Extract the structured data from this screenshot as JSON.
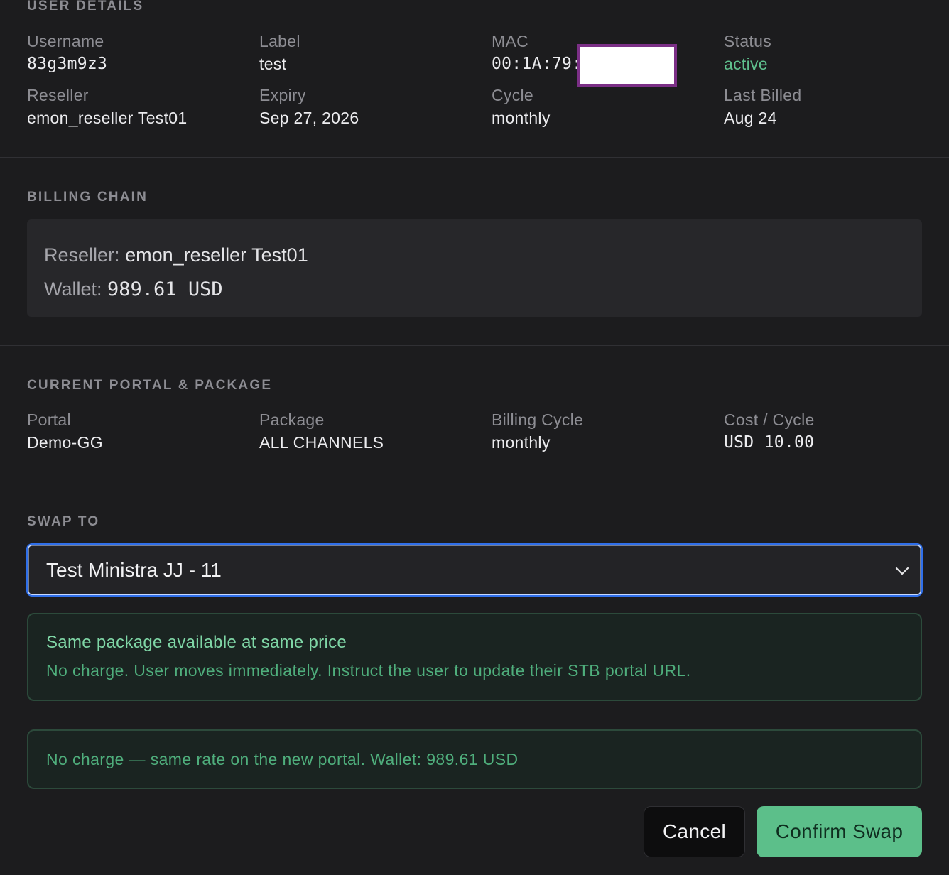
{
  "user_details": {
    "title": "USER DETAILS",
    "username": {
      "label": "Username",
      "value": "83g3m9z3"
    },
    "label": {
      "label": "Label",
      "value": "test"
    },
    "mac": {
      "label": "MAC",
      "value": "00:1A:79:"
    },
    "status": {
      "label": "Status",
      "value": "active"
    },
    "reseller": {
      "label": "Reseller",
      "value": "emon_reseller Test01"
    },
    "expiry": {
      "label": "Expiry",
      "value": "Sep 27, 2026"
    },
    "cycle": {
      "label": "Cycle",
      "value": "monthly"
    },
    "last_billed": {
      "label": "Last Billed",
      "value": "Aug 24"
    }
  },
  "billing_chain": {
    "title": "BILLING CHAIN",
    "reseller_key": "Reseller:",
    "reseller_value": "emon_reseller Test01",
    "wallet_key": "Wallet:",
    "wallet_value": "989.61 USD"
  },
  "current": {
    "title": "CURRENT PORTAL & PACKAGE",
    "portal": {
      "label": "Portal",
      "value": "Demo-GG"
    },
    "package": {
      "label": "Package",
      "value": "ALL CHANNELS"
    },
    "billing_cycle": {
      "label": "Billing Cycle",
      "value": "monthly"
    },
    "cost": {
      "label": "Cost / Cycle",
      "value": "USD 10.00"
    }
  },
  "swap": {
    "title": "SWAP TO",
    "selected": "Test Ministra JJ - 11"
  },
  "notice": {
    "title": "Same package available at same price",
    "detail": "No charge. User moves immediately. Instruct the user to update their STB portal URL."
  },
  "summary": {
    "text": "No charge — same rate on the new portal. Wallet: 989.61 USD"
  },
  "actions": {
    "cancel": "Cancel",
    "confirm": "Confirm Swap"
  },
  "colors": {
    "accent": "#5cbf8a",
    "status_active": "#5fc08e",
    "focus_border": "#2f6fea",
    "redaction_border": "#7b2f86"
  }
}
